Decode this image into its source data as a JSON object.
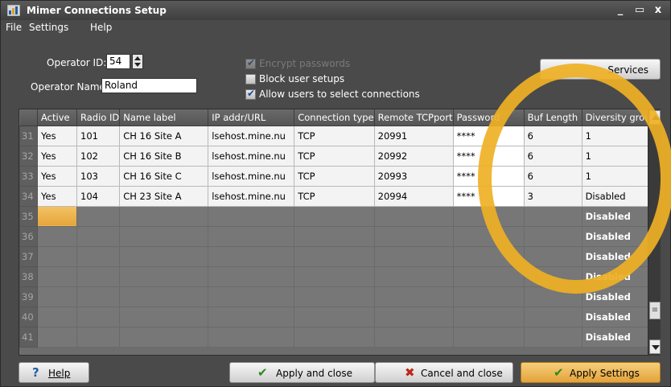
{
  "window": {
    "title": "Mimer Connections Setup",
    "controls": [
      "_",
      "▭",
      "x"
    ]
  },
  "menu": [
    "File",
    "Settings",
    "Help"
  ],
  "operator": {
    "id_label": "Operator ID:",
    "id_value": "54",
    "name_label": "Operator Name:",
    "name_value": "Roland"
  },
  "options": {
    "encrypt": {
      "label": "Encrypt passwords",
      "checked": true,
      "enabled": false
    },
    "block": {
      "label": "Block user setups",
      "checked": false,
      "enabled": true
    },
    "allow": {
      "label": "Allow users to select connections",
      "checked": true,
      "enabled": true
    }
  },
  "services_button": {
    "label": "Services"
  },
  "grid": {
    "columns": [
      "Active",
      "Radio ID",
      "Name label",
      "IP addr/URL",
      "Connection type",
      "Remote TCPport",
      "Password",
      "Buf Length",
      "Diversity group"
    ],
    "rows": [
      {
        "num": "31",
        "active": "Yes",
        "radio": "101",
        "name": "CH 16 Site A",
        "ip": "lsehost.mine.nu",
        "conn": "TCP",
        "port": "20991",
        "pw": "****",
        "buf": "6",
        "div": "1"
      },
      {
        "num": "32",
        "active": "Yes",
        "radio": "102",
        "name": "CH 16 Site B",
        "ip": "lsehost.mine.nu",
        "conn": "TCP",
        "port": "20992",
        "pw": "****",
        "buf": "6",
        "div": "1"
      },
      {
        "num": "33",
        "active": "Yes",
        "radio": "103",
        "name": "CH 16 Site C",
        "ip": "lsehost.mine.nu",
        "conn": "TCP",
        "port": "20993",
        "pw": "****",
        "buf": "6",
        "div": "1"
      },
      {
        "num": "34",
        "active": "Yes",
        "radio": "104",
        "name": "CH 23 Site A",
        "ip": "lsehost.mine.nu",
        "conn": "TCP",
        "port": "20994",
        "pw": "****",
        "buf": "3",
        "div": "Disabled"
      },
      {
        "num": "35",
        "active": "",
        "radio": "",
        "name": "",
        "ip": "",
        "conn": "",
        "port": "",
        "pw": "",
        "buf": "",
        "div": "Disabled"
      },
      {
        "num": "36",
        "active": "",
        "radio": "",
        "name": "",
        "ip": "",
        "conn": "",
        "port": "",
        "pw": "",
        "buf": "",
        "div": "Disabled"
      },
      {
        "num": "37",
        "active": "",
        "radio": "",
        "name": "",
        "ip": "",
        "conn": "",
        "port": "",
        "pw": "",
        "buf": "",
        "div": "Disabled"
      },
      {
        "num": "38",
        "active": "",
        "radio": "",
        "name": "",
        "ip": "",
        "conn": "",
        "port": "",
        "pw": "",
        "buf": "",
        "div": "Disabled"
      },
      {
        "num": "39",
        "active": "",
        "radio": "",
        "name": "",
        "ip": "",
        "conn": "",
        "port": "",
        "pw": "",
        "buf": "",
        "div": "Disabled"
      },
      {
        "num": "40",
        "active": "",
        "radio": "",
        "name": "",
        "ip": "",
        "conn": "",
        "port": "",
        "pw": "",
        "buf": "",
        "div": "Disabled"
      },
      {
        "num": "41",
        "active": "",
        "radio": "",
        "name": "",
        "ip": "",
        "conn": "",
        "port": "",
        "pw": "",
        "buf": "",
        "div": "Disabled"
      }
    ]
  },
  "buttons": {
    "help": "Help",
    "apply_close": "Apply and close",
    "cancel_close": "Cancel and close",
    "apply_settings": "Apply Settings"
  },
  "colors": {
    "highlight_ring": "#efb024",
    "selected_cell": "#e5a53b"
  }
}
